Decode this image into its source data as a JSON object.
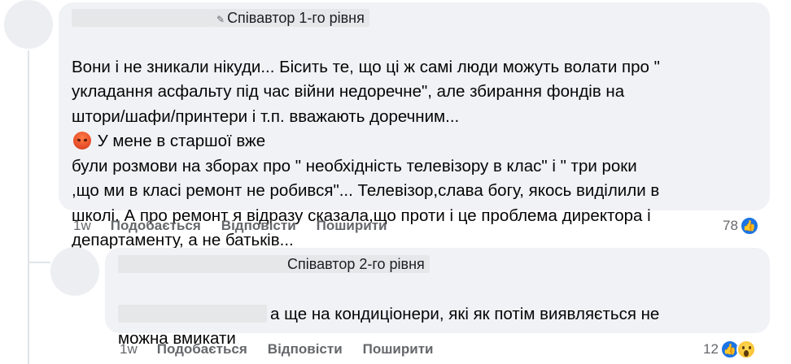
{
  "comment1": {
    "badge": "Співавтор 1-го рівня",
    "text": "Вони і не зникали нікуди... Бісить те, що ці ж самі люди можуть волати про \"\nукладання асфальту під час війни недоречне\", але збирання фондів на\nштори/шафи/принтери і т.п. вважають доречним...",
    "text_after_emoji": " У мене в старшої вже\nбули розмови на зборах про \" необхідність телевізору в клас\" і \" три роки\n,що ми в класі ремонт не робився\"... Телевізор,слава богу, якось виділили в\nшколі. А про ремонт я відразу сказала,що проти і це проблема директора і\nдепартаменту, а не батьків...",
    "emoji": "angry-face",
    "time": "1w",
    "like_label": "Подобається",
    "reply_label": "Відповісти",
    "share_label": "Поширити",
    "reaction_count": "78",
    "reactions": [
      "like"
    ]
  },
  "comment2": {
    "badge": "Співавтор 2-го рівня",
    "text": "а ще на кондиціонери, які як потім виявляється не\nможна вмикати",
    "time": "1w",
    "like_label": "Подобається",
    "reply_label": "Відповісти",
    "share_label": "Поширити",
    "reaction_count": "12",
    "reactions": [
      "like",
      "wow"
    ]
  },
  "colors": {
    "bubble": "#f0f2f5",
    "secondary_text": "#65676b",
    "like_blue": "#1b74e4"
  }
}
